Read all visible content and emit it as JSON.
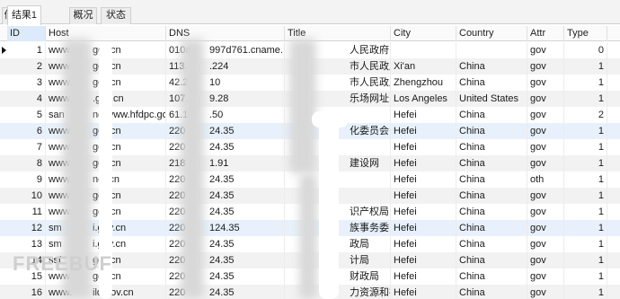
{
  "tabs": [
    {
      "label": "信息",
      "active": false
    },
    {
      "label": "结果1",
      "active": true
    },
    {
      "label": "概况",
      "active": false
    },
    {
      "label": "状态",
      "active": false
    }
  ],
  "columns": [
    "ID",
    "Host",
    "DNS",
    "Title",
    "City",
    "Country",
    "Attr",
    "Type"
  ],
  "rows": [
    {
      "id": "1",
      "host": "www.",
      "host2": "gov.cn",
      "dns": "010a",
      "dns2": "997d761.cname.",
      "title": "人民政府",
      "city": "",
      "country": "",
      "attr": "gov",
      "type": "0"
    },
    {
      "id": "2",
      "host": "www.",
      "host2": "gov.cn",
      "dns": "113.",
      "dns2": ".224",
      "title": "市人民政府",
      "city": "Xi'an",
      "country": "China",
      "attr": "gov",
      "type": "1"
    },
    {
      "id": "3",
      "host": "www.",
      "host2": "gov.cn",
      "dns": "42.2",
      "dns2": "10",
      "title": "市人民政府",
      "city": "Zhengzhou",
      "country": "China",
      "attr": "gov",
      "type": "1"
    },
    {
      "id": "4",
      "host": "www.",
      "host2": ".gov.cn",
      "dns": "107.",
      "dns2": "9.28",
      "title": "乐场网址",
      "city": "Los Angeles",
      "country": "United States",
      "attr": "gov",
      "type": "1"
    },
    {
      "id": "5",
      "host": "san",
      "host2": "ng.www.hfdpc.gov",
      "dns": "61.1",
      "dns2": ".50",
      "title": "",
      "city": "Hefei",
      "country": "China",
      "attr": "gov",
      "type": "2"
    },
    {
      "id": "6",
      "host": "www.",
      "host2": "gov.cn",
      "dns": "220",
      "dns2": "24.35",
      "title": "化委员会",
      "city": "Hefei",
      "country": "China",
      "attr": "gov",
      "type": "1"
    },
    {
      "id": "7",
      "host": "www.",
      "host2": "gov.cn",
      "dns": "220",
      "dns2": "24.35",
      "title": "",
      "city": "Hefei",
      "country": "China",
      "attr": "gov",
      "type": "1"
    },
    {
      "id": "8",
      "host": "www.",
      "host2": "gov.cn",
      "dns": "218",
      "dns2": "1.91",
      "title": "建设网",
      "city": "Hefei",
      "country": "China",
      "attr": "gov",
      "type": "1"
    },
    {
      "id": "9",
      "host": "www.",
      "host2": "net.cn",
      "dns": "220",
      "dns2": "24.35",
      "title": "",
      "city": "Hefei",
      "country": "China",
      "attr": "oth",
      "type": "1"
    },
    {
      "id": "10",
      "host": "www.",
      "host2": "gov.cn",
      "dns": "220",
      "dns2": "24.35",
      "title": "",
      "city": "Hefei",
      "country": "China",
      "attr": "gov",
      "type": "1"
    },
    {
      "id": "11",
      "host": "www.",
      "host2": "gov.cn",
      "dns": "220",
      "dns2": "24.35",
      "title": "识产权局",
      "city": "Hefei",
      "country": "China",
      "attr": "gov",
      "type": "1"
    },
    {
      "id": "12",
      "host": "sm",
      "host2": "i.gov.cn",
      "dns": "220",
      "dns2": "124.35",
      "title": "族事务委员会",
      "city": "Hefei",
      "country": "China",
      "attr": "gov",
      "type": "1"
    },
    {
      "id": "13",
      "host": "sm",
      "host2": "i.gov.cn",
      "dns": "220",
      "dns2": "24.35",
      "title": "政局",
      "city": "Hefei",
      "country": "China",
      "attr": "gov",
      "type": "1"
    },
    {
      "id": "14",
      "host": "ssf",
      "host2": "gov.cn",
      "dns": "220",
      "dns2": "24.35",
      "title": "计局",
      "city": "Hefei",
      "country": "China",
      "attr": "gov",
      "type": "1"
    },
    {
      "id": "15",
      "host": "www.",
      "host2": "gov.cn",
      "dns": "220",
      "dns2": "24.35",
      "title": "财政局",
      "city": "Hefei",
      "country": "China",
      "attr": "gov",
      "type": "1"
    },
    {
      "id": "16",
      "host": "www.",
      "host2": "ild.gov.cn",
      "dns": "220",
      "dns2": "24.35",
      "title": "力资源和社会保障",
      "city": "Hefei",
      "country": "China",
      "attr": "gov",
      "type": "1"
    }
  ],
  "watermark": "FREEBUF",
  "colors": {
    "header_sorted": "#dceaf9",
    "row_alt": "#f2f2f2",
    "row_selected": "#e8f1fb"
  }
}
